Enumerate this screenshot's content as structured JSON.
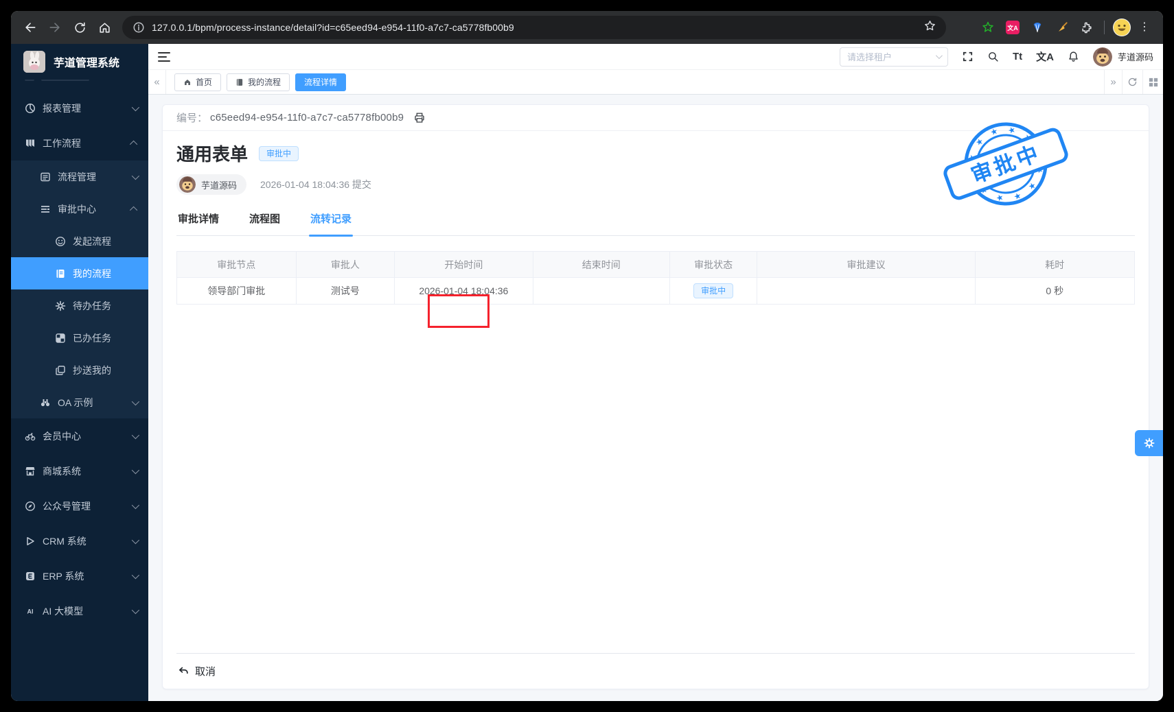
{
  "colors": {
    "accent": "#409eff",
    "stamp_blue": "#2086f3",
    "annotation_red": "#f5222d",
    "sidebar_bg": "#0d2136",
    "sidebar_submenu_bg": "#152b42"
  },
  "browser": {
    "url": "127.0.0.1/bpm/process-instance/detail?id=c65eed94-e954-11f0-a7c7-ca5778fb00b9"
  },
  "sidebar": {
    "app_title": "芋道管理系统",
    "menu": [
      {
        "label": "报表管理"
      },
      {
        "label": "工作流程"
      },
      {
        "label": "流程管理"
      },
      {
        "label": "审批中心"
      },
      {
        "label": "发起流程"
      },
      {
        "label": "我的流程"
      },
      {
        "label": "待办任务"
      },
      {
        "label": "已办任务"
      },
      {
        "label": "抄送我的"
      },
      {
        "label": "OA 示例"
      },
      {
        "label": "会员中心"
      },
      {
        "label": "商城系统"
      },
      {
        "label": "公众号管理"
      },
      {
        "label": "CRM 系统"
      },
      {
        "label": "ERP 系统"
      },
      {
        "label": "AI 大模型"
      }
    ]
  },
  "header": {
    "tenant_placeholder": "请选择租户",
    "font_size_icon": "Tt",
    "locale_icon": "文A",
    "username": "芋道源码"
  },
  "tags": {
    "items": [
      {
        "label": "首页"
      },
      {
        "label": "我的流程"
      },
      {
        "label": "流程详情"
      }
    ]
  },
  "main": {
    "serial_label": "编号：",
    "serial_value": "c65eed94-e954-11f0-a7c7-ca5778fb00b9",
    "title": "通用表单",
    "status_badge": "审批中",
    "submitter": "芋道源码",
    "submit_time": "2026-01-04 18:04:36 提交",
    "tabs": [
      {
        "label": "审批详情"
      },
      {
        "label": "流程图"
      },
      {
        "label": "流转记录"
      }
    ],
    "stamp_text": "审批中",
    "table": {
      "columns": [
        "审批节点",
        "审批人",
        "开始时间",
        "结束时间",
        "审批状态",
        "审批建议",
        "耗时"
      ],
      "row": {
        "node": "领导部门审批",
        "approver": "测试号",
        "start": "2026-01-04 18:04:36",
        "end": "",
        "status": "审批中",
        "suggestion": "",
        "duration": "0 秒"
      }
    },
    "cancel_label": "取消"
  }
}
